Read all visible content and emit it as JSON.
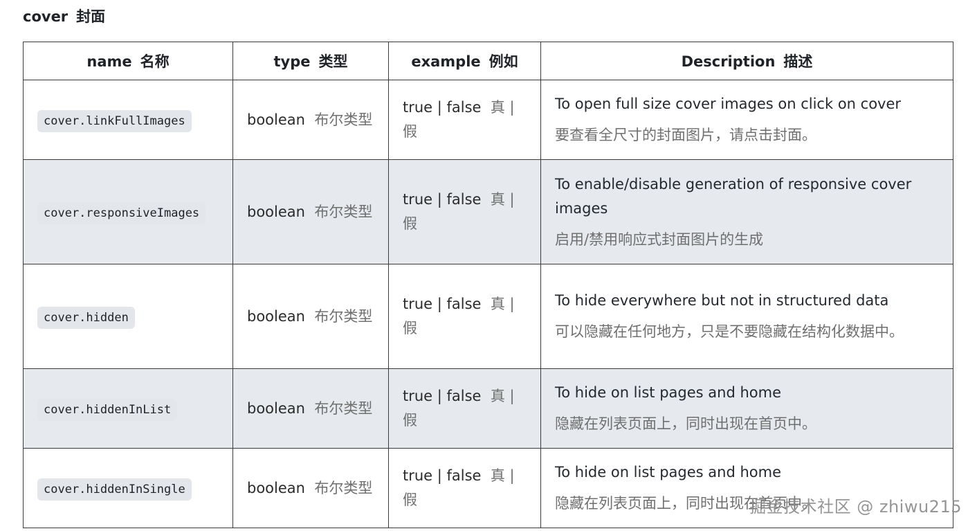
{
  "section": {
    "title_en": "cover",
    "title_zh": "封面"
  },
  "table": {
    "headers": [
      {
        "en": "name",
        "zh": "名称"
      },
      {
        "en": "type",
        "zh": "类型"
      },
      {
        "en": "example",
        "zh": "例如"
      },
      {
        "en": "Description",
        "zh": "描述"
      }
    ],
    "rows": [
      {
        "name": "cover.linkFullImages",
        "type_en": "boolean",
        "type_zh": "布尔类型",
        "example_en": "true | false",
        "example_zh": "真 | 假",
        "desc_en": "To open full size cover images on click on cover",
        "desc_zh": "要查看全尺寸的封面图片，请点击封面。"
      },
      {
        "name": "cover.responsiveImages",
        "type_en": "boolean",
        "type_zh": "布尔类型",
        "example_en": "true | false",
        "example_zh": "真 | 假",
        "desc_en": "To enable/disable generation of responsive cover images",
        "desc_zh": "启用/禁用响应式封面图片的生成"
      },
      {
        "name": "cover.hidden",
        "type_en": "boolean",
        "type_zh": "布尔类型",
        "example_en": "true | false",
        "example_zh": "真 | 假",
        "desc_en": "To hide everywhere but not in structured data",
        "desc_zh": "可以隐藏在任何地方，只是不要隐藏在结构化数据中。"
      },
      {
        "name": "cover.hiddenInList",
        "type_en": "boolean",
        "type_zh": "布尔类型",
        "example_en": "true | false",
        "example_zh": "真 | 假",
        "desc_en": "To hide on list pages and home",
        "desc_zh": "隐藏在列表页面上，同时出现在首页中。"
      },
      {
        "name": "cover.hiddenInSingle",
        "type_en": "boolean",
        "type_zh": "布尔类型",
        "example_en": "true | false",
        "example_zh": "真 | 假",
        "desc_en": "To hide on list pages and home",
        "desc_zh": "隐藏在列表页面上，同时出现在首页中。"
      }
    ]
  },
  "watermark": "掘金技术社区 @ zhiwu215"
}
